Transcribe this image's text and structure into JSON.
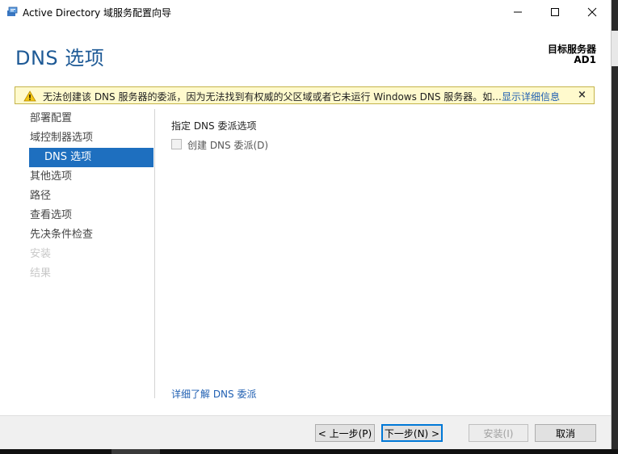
{
  "window": {
    "title": "Active Directory 域服务配置向导",
    "controls": {
      "minimize": "minimize",
      "maximize": "maximize",
      "close": "close"
    }
  },
  "header": {
    "page_title": "DNS 选项",
    "target_label": "目标服务器",
    "target_name": "AD1"
  },
  "warning": {
    "icon": "warning-icon",
    "text": "无法创建该 DNS 服务器的委派，因为无法找到有权威的父区域或者它未运行 Windows DNS 服务器。如...",
    "link": "显示详细信息",
    "close": "×",
    "colors": {
      "background": "#fffacd",
      "border": "#c5b44a"
    }
  },
  "nav": {
    "items": [
      {
        "label": "部署配置",
        "state": "normal"
      },
      {
        "label": "域控制器选项",
        "state": "normal"
      },
      {
        "label": "DNS 选项",
        "state": "active"
      },
      {
        "label": "其他选项",
        "state": "normal"
      },
      {
        "label": "路径",
        "state": "normal"
      },
      {
        "label": "查看选项",
        "state": "normal"
      },
      {
        "label": "先决条件检查",
        "state": "normal"
      },
      {
        "label": "安装",
        "state": "disabled"
      },
      {
        "label": "结果",
        "state": "disabled"
      }
    ],
    "active_color": "#1e6fbf"
  },
  "content": {
    "section_label": "指定 DNS 委派选项",
    "checkbox": {
      "label": "创建 DNS 委派(D)",
      "checked": false,
      "enabled": false
    },
    "learn_link": "详细了解 DNS 委派"
  },
  "footer": {
    "prev": "< 上一步(P)",
    "next": "下一步(N) >",
    "install": "安装(I)",
    "cancel": "取消"
  },
  "accent": "#1e5a96"
}
